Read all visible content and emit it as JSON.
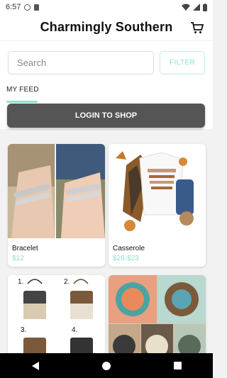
{
  "status_bar": {
    "time": "6:57"
  },
  "header": {
    "title": "Charmingly Southern"
  },
  "search": {
    "placeholder": "Search"
  },
  "filter": {
    "label": "FILTER"
  },
  "feed": {
    "tab_label": "MY FEED"
  },
  "login": {
    "label": "LOGIN TO SHOP"
  },
  "products": [
    {
      "name": "Bracelet",
      "price": "$12"
    },
    {
      "name": "Casserole",
      "price": "$20-$23"
    },
    {
      "name": "",
      "price": ""
    },
    {
      "name": "",
      "price": ""
    }
  ],
  "product3_labels": [
    "1.",
    "2.",
    "3.",
    "4."
  ],
  "colors": {
    "accent": "#8fe0cf",
    "button": "#555555"
  }
}
